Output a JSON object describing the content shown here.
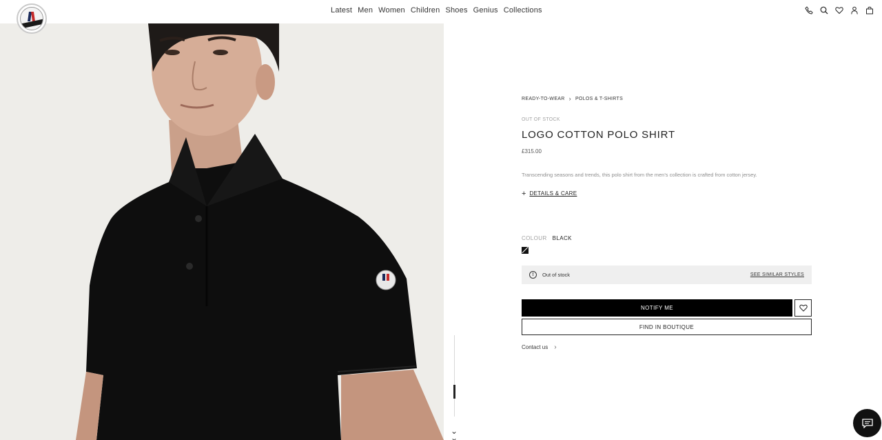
{
  "header": {
    "logo_icon": "moncler-logo-icon",
    "nav": [
      "Latest",
      "Men",
      "Women",
      "Children",
      "Shoes",
      "Genius",
      "Collections"
    ],
    "icons": [
      "phone-icon",
      "search-icon",
      "heart-icon",
      "user-icon",
      "bag-icon"
    ]
  },
  "product": {
    "breadcrumb": [
      "READY-TO-WEAR",
      "POLOS & T-SHIRTS"
    ],
    "stock_label": "OUT OF STOCK",
    "title": "LOGO COTTON POLO SHIRT",
    "price": "£315.00",
    "description": "Transcending seasons and trends, this polo shirt from the men's collection is crafted from cotton jersey.",
    "details_link": "DETAILS & CARE",
    "colour_label": "COLOUR",
    "colour_value": "BLACK",
    "stock_message": "Out of stock",
    "similar_styles": "SEE SIMILAR STYLES",
    "notify_button": "NOTIFY ME",
    "boutique_button": "FIND IN BOUTIQUE",
    "contact_link": "Contact us"
  },
  "colors": {
    "primary": "#000000",
    "background": "#ffffff",
    "muted_text": "#a0a0a0",
    "oos_bar_bg": "#efefef",
    "hero_bg": "#eeede9"
  }
}
